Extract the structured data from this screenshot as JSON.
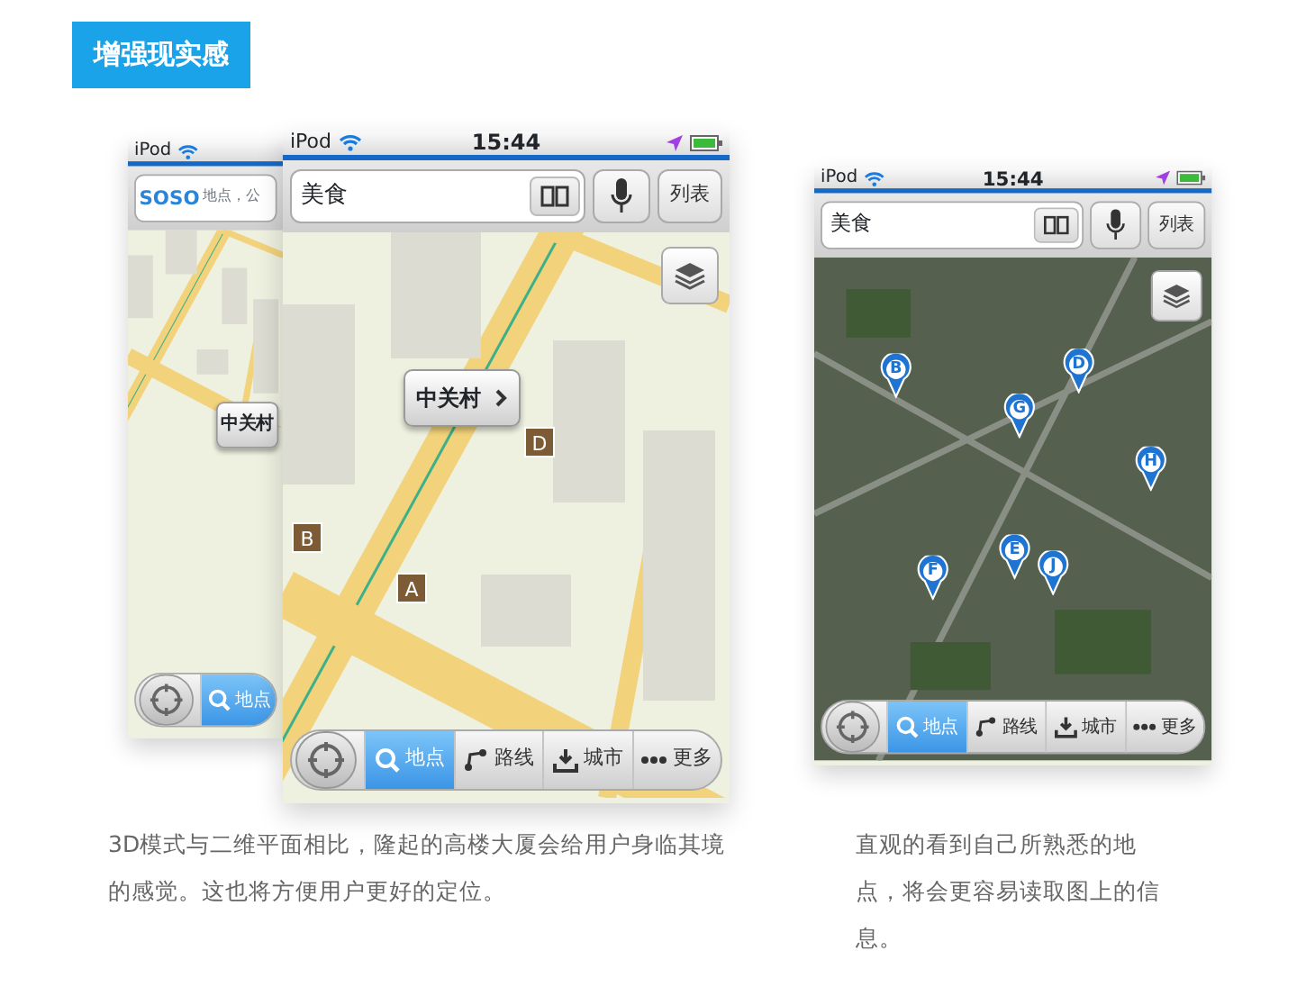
{
  "header": {
    "title": "增强现实感"
  },
  "phones": [
    {
      "status": {
        "carrier": "iPod"
      },
      "search": {
        "kind": "logo",
        "logo": "SOSO",
        "placeholder": "地点，公"
      },
      "map": {
        "kind": "street",
        "callout": {
          "label": "中关村"
        }
      },
      "tabs": [
        {
          "kind": "search",
          "label": "地点",
          "selected": true
        }
      ]
    },
    {
      "status": {
        "carrier": "iPod",
        "time": "15:44"
      },
      "search": {
        "kind": "query",
        "value": "美食"
      },
      "voice_button": true,
      "list_button": "列表",
      "map": {
        "kind": "street",
        "layers_button": true,
        "callout": {
          "label": "中关村",
          "chevron": true
        },
        "markers": [
          {
            "label": "D"
          },
          {
            "label": "B"
          },
          {
            "label": "A"
          }
        ]
      },
      "tabs": [
        {
          "kind": "search",
          "label": "地点",
          "selected": true
        },
        {
          "kind": "route",
          "label": "路线",
          "selected": false
        },
        {
          "kind": "download",
          "label": "城市",
          "selected": false
        },
        {
          "kind": "more",
          "label": "更多",
          "selected": false
        }
      ]
    },
    {
      "status": {
        "carrier": "iPod",
        "time": "15:44"
      },
      "search": {
        "kind": "query",
        "value": "美食"
      },
      "voice_button": true,
      "list_button": "列表",
      "map": {
        "kind": "satellite",
        "layers_button": true,
        "markers": [
          {
            "label": "B"
          },
          {
            "label": "D"
          },
          {
            "label": "G"
          },
          {
            "label": "H"
          },
          {
            "label": "F"
          },
          {
            "label": "E"
          },
          {
            "label": "J"
          }
        ]
      },
      "tabs": [
        {
          "kind": "search",
          "label": "地点",
          "selected": true
        },
        {
          "kind": "route",
          "label": "路线",
          "selected": false
        },
        {
          "kind": "download",
          "label": "城市",
          "selected": false
        },
        {
          "kind": "more",
          "label": "更多",
          "selected": false
        }
      ]
    }
  ],
  "captions": [
    "3D模式与二维平面相比，隆起的高楼大厦会给用户身临其境的感觉。这也将方便用户更好的定位。",
    "直观的看到自己所熟悉的地点，将会更容易读取图上的信息。"
  ]
}
